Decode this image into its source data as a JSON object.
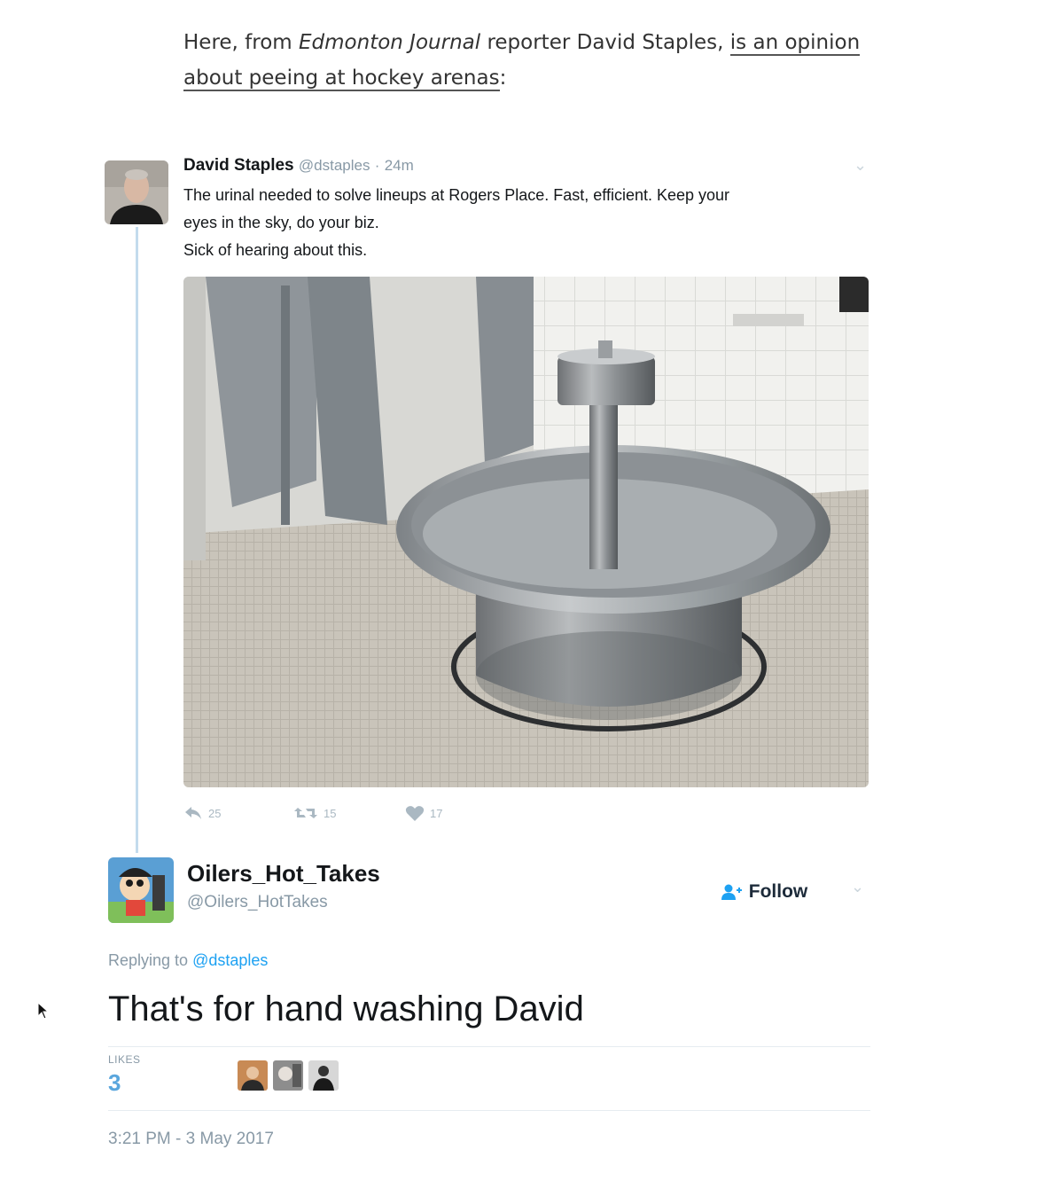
{
  "article": {
    "intro_before": "Here, from ",
    "intro_publication": "Edmonton Journal",
    "intro_middle": " reporter David Staples, ",
    "intro_link": "is an opinion about peeing at hockey arenas",
    "intro_end": ":"
  },
  "tweet1": {
    "name": "David Staples",
    "handle": "@dstaples",
    "separator": "·",
    "time": "24m",
    "lines": [
      "The urinal needed to solve lineups at Rogers Place. Fast, efficient. Keep your",
      "eyes in the sky, do your biz.",
      "Sick of hearing about this."
    ],
    "reply_count": "25",
    "retweet_count": "15",
    "like_count": "17",
    "chevron": "⌄"
  },
  "tweet2": {
    "name": "Oilers_Hot_Takes",
    "handle": "@Oilers_HotTakes",
    "follow_label": "Follow",
    "chevron": "⌄",
    "replying_prefix": "Replying to ",
    "replying_handle": "@dstaples",
    "text": "That's for hand washing David",
    "likes_label": "LIKES",
    "likes_count": "3",
    "timestamp": "3:21 PM - 3 May 2017"
  },
  "colors": {
    "twitter_blue": "#1da1f2",
    "muted": "#8899a6",
    "thread_line": "#c3dbed"
  },
  "icons": [
    "reply-icon",
    "retweet-icon",
    "heart-icon",
    "add-user-icon",
    "chevron-down-icon",
    "mouse-cursor-icon"
  ]
}
